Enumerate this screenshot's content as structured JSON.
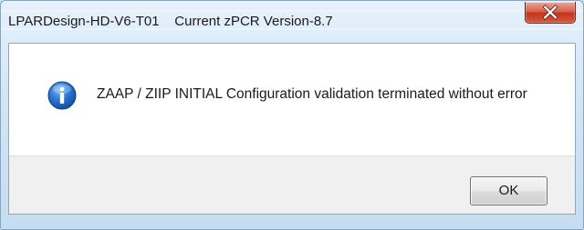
{
  "window": {
    "title": "LPARDesign-HD-V6-T01    Current zPCR Version-8.7"
  },
  "title_bar": {
    "close_icon": "close-x-icon"
  },
  "message": {
    "icon": "information-icon",
    "text": "ZAAP / ZIIP INITIAL Configuration validation terminated without error"
  },
  "buttons": {
    "ok_label": "OK"
  },
  "colors": {
    "close_button": "#c9452b",
    "info_icon": "#1f66c4",
    "frame": "#c9dff1",
    "button_strip": "#f0f0f0"
  }
}
